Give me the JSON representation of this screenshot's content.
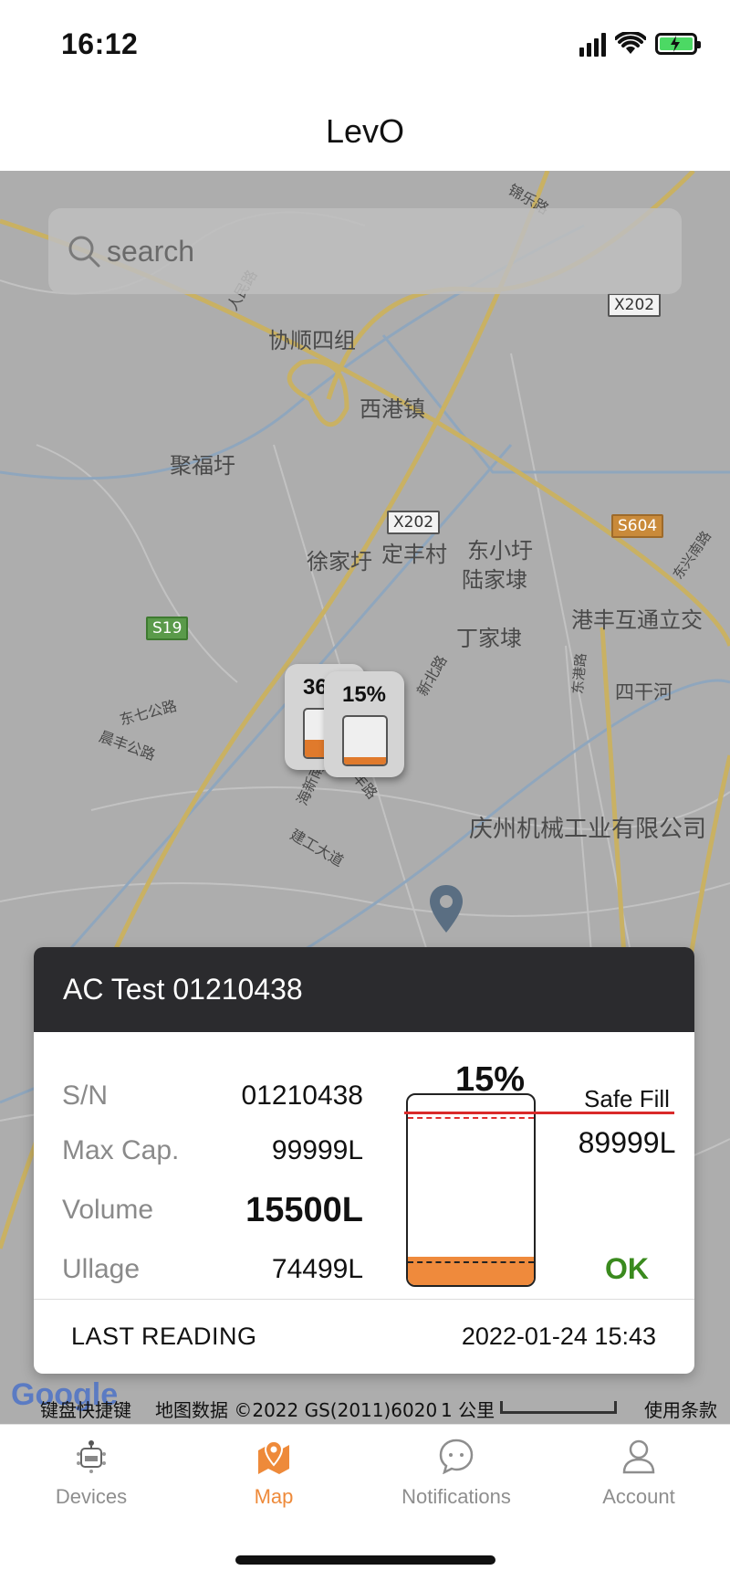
{
  "status_bar": {
    "time": "16:12"
  },
  "header": {
    "title": "LevO"
  },
  "search": {
    "placeholder": "search"
  },
  "map": {
    "labels": [
      "协顺四组",
      "西港镇",
      "聚福圩",
      "定丰村",
      "东小圩",
      "陆家埭",
      "徐家圩",
      "丁家埭",
      "港丰互通立交",
      "四干河",
      "庆州机械工业有限公司",
      "东七公路",
      "晨丰公路",
      "海新南路",
      "海丰路",
      "建工大道",
      "东港路",
      "新北路",
      "人民路",
      "锦乐路",
      "东兴南路"
    ],
    "road_signs": [
      "X202",
      "X202",
      "S604",
      "S19"
    ],
    "markers": [
      {
        "pct": "36%",
        "fill_fraction": 0.36
      },
      {
        "pct": "15%",
        "fill_fraction": 0.15
      }
    ],
    "attribution": {
      "shortcuts": "键盘快捷键",
      "data": "地图数据 ©2022 GS(2011)6020",
      "scale": "1 公里",
      "terms": "使用条款"
    },
    "logo": "Google"
  },
  "card": {
    "title": "AC Test 01210438",
    "rows": [
      {
        "label": "S/N",
        "value": "01210438"
      },
      {
        "label": "Max Cap.",
        "value": "99999L"
      },
      {
        "label": "Volume",
        "value": "15500L"
      },
      {
        "label": "Ullage",
        "value": "74499L"
      }
    ],
    "gauge": {
      "percent": "15%",
      "fill_fraction": 0.15,
      "safe_fill_label": "Safe Fill",
      "safe_fill_value": "89999L",
      "status": "OK",
      "fill_color": "#ef8a3c",
      "status_color": "#3a8a1e"
    },
    "last_reading_label": "LAST READING",
    "last_reading_value": "2022-01-24 15:43"
  },
  "tabs": [
    {
      "label": "Devices",
      "icon": "levo-device-icon",
      "active": false
    },
    {
      "label": "Map",
      "icon": "map-pin-icon",
      "active": true
    },
    {
      "label": "Notifications",
      "icon": "chat-bubble-icon",
      "active": false
    },
    {
      "label": "Account",
      "icon": "person-icon",
      "active": false
    }
  ],
  "colors": {
    "accent": "#ee8a3a",
    "header_dark": "#2b2b2e",
    "map_bg": "#adadad"
  }
}
